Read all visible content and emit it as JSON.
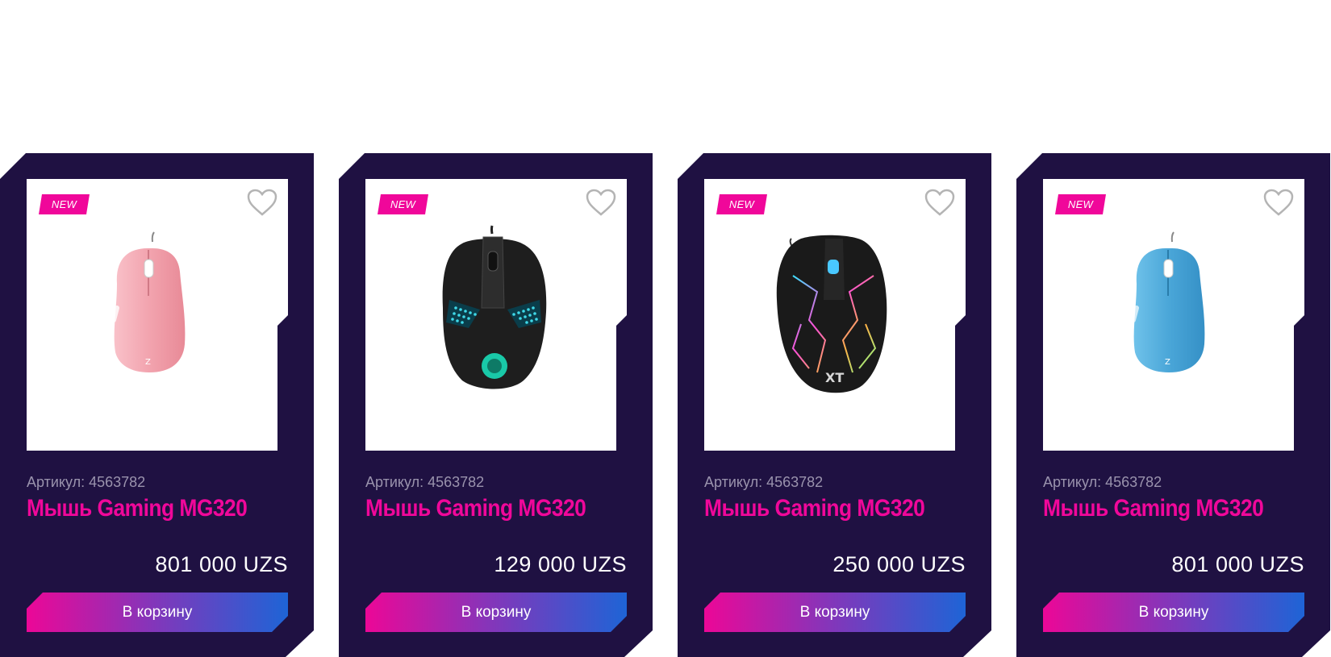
{
  "products": [
    {
      "badge": "NEW",
      "icon": "mouse-pink",
      "sku": "Артикул: 4563782",
      "title": "Мышь Gaming MG320",
      "price": "801 000 UZS",
      "cart_label": "В корзину"
    },
    {
      "badge": "NEW",
      "icon": "mouse-black-2e",
      "sku": "Артикул: 4563782",
      "title": "Мышь Gaming MG320",
      "price": "129 000 UZS",
      "cart_label": "В корзину"
    },
    {
      "badge": "NEW",
      "icon": "mouse-black-rgb",
      "sku": "Артикул: 4563782",
      "title": "Мышь Gaming MG320",
      "price": "250 000 UZS",
      "cart_label": "В корзину"
    },
    {
      "badge": "NEW",
      "icon": "mouse-blue",
      "sku": "Артикул: 4563782",
      "title": "Мышь Gaming MG320",
      "price": "801 000 UZS",
      "cart_label": "В корзину"
    }
  ],
  "colors": {
    "card_bg": "#1f1142",
    "accent": "#f0079a",
    "sku_text": "#9a93ad",
    "price_text": "#ffffff",
    "gradient_start": "#ec0797",
    "gradient_end": "#1e64d6"
  }
}
